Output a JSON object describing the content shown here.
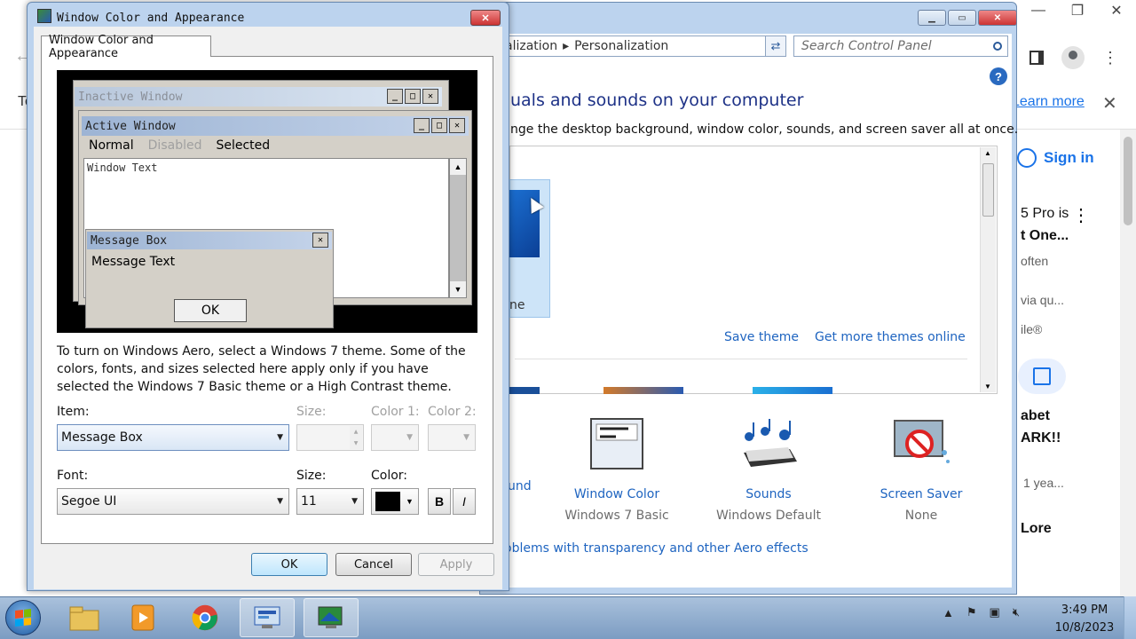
{
  "browser": {
    "partial_left_text": "To",
    "learn_more": "Learn more",
    "sign_in": "Sign in",
    "feed": [
      {
        "text": "5 Pro is",
        "style": "b"
      },
      {
        "text": "t One...",
        "style": "b"
      },
      {
        "text": "often",
        "style": "g"
      },
      {
        "text": "via qu...",
        "style": "g"
      },
      {
        "text": "ile®",
        "style": "g"
      },
      {
        "text": "abet",
        "style": "b"
      },
      {
        "text": "ARK!!",
        "style": "b"
      },
      {
        "text": "1 yea...",
        "style": "g"
      },
      {
        "text": "Lore",
        "style": "b"
      }
    ]
  },
  "control_panel": {
    "breadcrumb": [
      "alization",
      "Personalization"
    ],
    "search_placeholder": "Search Control Panel",
    "heading": "uals and sounds on your computer",
    "subheading": "nge the desktop background, window color, sounds, and screen saver all at once.",
    "theme_partial_name": "ne",
    "save_theme": "Save theme",
    "get_more_themes": "Get more themes online",
    "partial_background_label": "und",
    "items": [
      {
        "title": "Window Color",
        "subtitle": "Windows 7 Basic",
        "icon": "window-color-icon"
      },
      {
        "title": "Sounds",
        "subtitle": "Windows Default",
        "icon": "sounds-icon"
      },
      {
        "title": "Screen Saver",
        "subtitle": "None",
        "icon": "screen-saver-icon"
      }
    ],
    "aero_link": "oblems with transparency and other Aero effects"
  },
  "dialog": {
    "title": "Window Color and Appearance",
    "tab": "Window Color and Appearance",
    "preview": {
      "inactive_title": "Inactive Window",
      "active_title": "Active Window",
      "menu": {
        "normal": "Normal",
        "disabled": "Disabled",
        "selected": "Selected"
      },
      "window_text": "Window Text",
      "msgbox_title": "Message Box",
      "msgbox_text": "Message Text",
      "msgbox_ok": "OK"
    },
    "info": "To turn on Windows Aero, select a Windows 7 theme.  Some of the colors, fonts, and sizes selected here apply only if you have selected the Windows 7 Basic theme or a High Contrast theme.",
    "labels": {
      "item": "Item:",
      "size1": "Size:",
      "color1": "Color 1:",
      "color2": "Color 2:",
      "font": "Font:",
      "size2": "Size:",
      "color": "Color:"
    },
    "values": {
      "item": "Message Box",
      "font": "Segoe UI",
      "size": "11",
      "bold": "B",
      "italic": "I",
      "font_color": "#000000"
    },
    "buttons": {
      "ok": "OK",
      "cancel": "Cancel",
      "apply": "Apply"
    }
  },
  "taskbar": {
    "apps": [
      "file-explorer-icon",
      "media-center-icon",
      "chrome-icon",
      "control-panel-icon",
      "personalization-icon"
    ],
    "time": "3:49 PM",
    "date": "10/8/2023"
  }
}
